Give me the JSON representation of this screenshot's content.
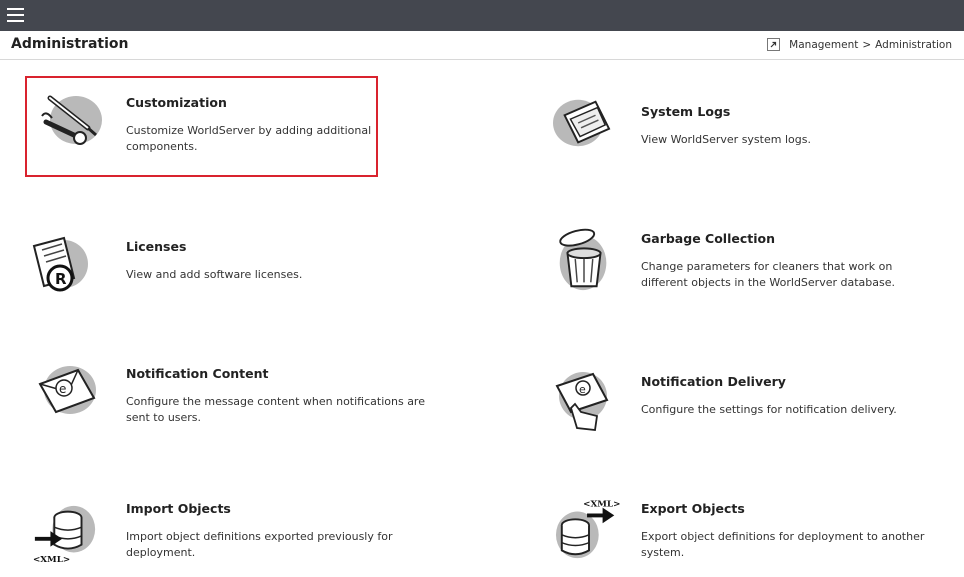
{
  "header": {
    "title": "Administration",
    "breadcrumb": [
      "Management",
      "Administration"
    ],
    "breadcrumb_separator": ">"
  },
  "tiles": [
    {
      "title": "Customization",
      "description": "Customize WorldServer by adding additional components.",
      "icon": "tools-icon"
    },
    {
      "title": "System Logs",
      "description": "View WorldServer system logs.",
      "icon": "logs-icon"
    },
    {
      "title": "Licenses",
      "description": "View and add software licenses.",
      "icon": "license-icon"
    },
    {
      "title": "Garbage Collection",
      "description": "Change parameters for cleaners that work on different objects in the WorldServer database.",
      "icon": "trash-can-icon"
    },
    {
      "title": "Notification Content",
      "description": "Configure the message content when notifications are sent to users.",
      "icon": "envelope-icon"
    },
    {
      "title": "Notification Delivery",
      "description": "Configure the settings for notification delivery.",
      "icon": "envelope-hand-icon"
    },
    {
      "title": "Import Objects",
      "description": "Import object definitions exported previously for deployment.",
      "icon": "import-xml-icon",
      "icon_text": "<XML>"
    },
    {
      "title": "Export Objects",
      "description": "Export object definitions for deployment to another system.",
      "icon": "export-xml-icon",
      "icon_text": "<XML>"
    }
  ],
  "colors": {
    "topbar": "#44474f",
    "highlight": "#d9232e"
  }
}
